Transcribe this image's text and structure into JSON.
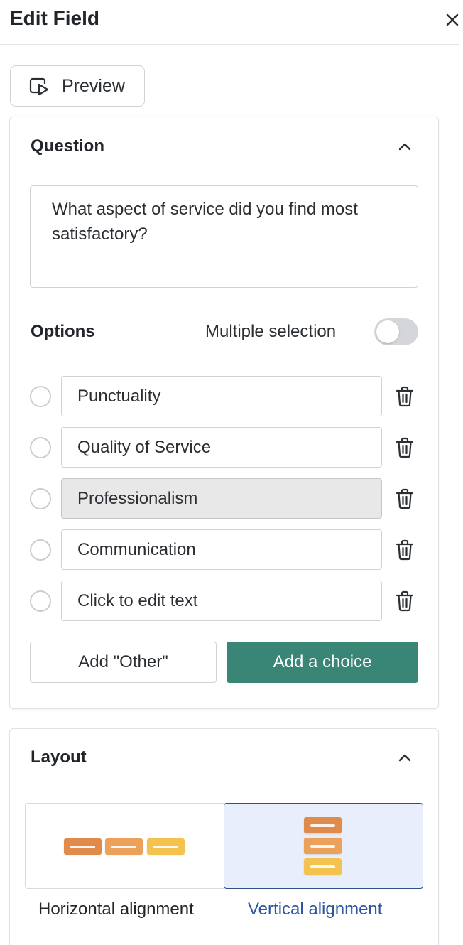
{
  "header": {
    "title": "Edit Field",
    "close_icon": "close-icon"
  },
  "toolbar": {
    "preview_label": "Preview",
    "preview_icon": "preview-play-icon"
  },
  "question_section": {
    "title": "Question",
    "collapse_icon": "chevron-up-icon",
    "question_text": "What aspect of service did you find most satisfactory?"
  },
  "options_section": {
    "title": "Options",
    "multiple_selection_label": "Multiple selection",
    "multiple_selection_enabled": false,
    "items": [
      {
        "label": "Punctuality",
        "highlighted": false
      },
      {
        "label": "Quality of Service",
        "highlighted": false
      },
      {
        "label": "Professionalism",
        "highlighted": true
      },
      {
        "label": "Communication",
        "highlighted": false
      },
      {
        "label": "Click to edit text",
        "highlighted": false
      }
    ],
    "add_other_label": "Add \"Other\"",
    "add_choice_label": "Add a choice"
  },
  "layout_section": {
    "title": "Layout",
    "collapse_icon": "chevron-up-icon",
    "horizontal_label": "Horizontal alignment",
    "vertical_label": "Vertical alignment",
    "selected": "vertical"
  },
  "colors": {
    "accent_green": "#3a8676",
    "selected_blue_text": "#2c56a1",
    "selected_bg": "#e8eefb",
    "bar_orange": "#e08a4c",
    "bar_light_orange": "#eba15a",
    "bar_yellow": "#f4c24e"
  }
}
